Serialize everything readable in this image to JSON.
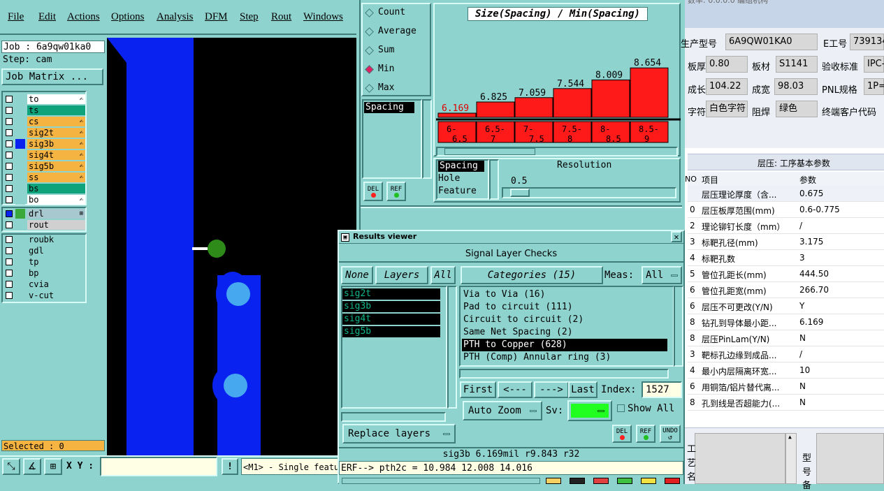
{
  "menu": [
    "File",
    "Edit",
    "Actions",
    "Options",
    "Analysis",
    "DFM",
    "Step",
    "Rout",
    "Windows"
  ],
  "job": {
    "job_label": "Job : 6a9qw01ka0",
    "step_label": "Step: cam",
    "matrix_btn": "Job Matrix ..."
  },
  "layers": [
    {
      "name": "to",
      "color": "#ffffff",
      "mark": "✍"
    },
    {
      "name": "ts",
      "color": "#0ea37a",
      "mark": ""
    },
    {
      "name": "cs",
      "color": "#f5b342",
      "mark": "✍"
    },
    {
      "name": "sig2t",
      "color": "#f5b342",
      "mark": "✍"
    },
    {
      "name": "sig3b",
      "color": "#f5b342",
      "mark": "✍"
    },
    {
      "name": "sig4t",
      "color": "#f5b342",
      "mark": "✍"
    },
    {
      "name": "sig5b",
      "color": "#f5b342",
      "mark": "✍"
    },
    {
      "name": "ss",
      "color": "#f5b342",
      "mark": "✍"
    },
    {
      "name": "bs",
      "color": "#0ea37a",
      "mark": ""
    },
    {
      "name": "bo",
      "color": "#ffffff",
      "mark": "✍"
    }
  ],
  "drill_layers": [
    {
      "name": "drl",
      "color": "#a8c8d0",
      "mark": "⊞"
    },
    {
      "name": "rout",
      "color": "#d0d0d0",
      "mark": ""
    }
  ],
  "other_layers": [
    "roubk",
    "gdl",
    "tp",
    "bp",
    "cvia",
    "v-cut"
  ],
  "selected_text": "Selected : 0",
  "xy_label": "X Y :",
  "status_msg": "<M1> - Single featu",
  "stats": {
    "options": [
      "Count",
      "Average",
      "Sum",
      "Min",
      "Max"
    ],
    "selected": "Min",
    "list_item": "Spacing",
    "del": "DEL",
    "ref": "REF"
  },
  "chart_data": {
    "type": "bar",
    "title": "Size(Spacing) / Min(Spacing)",
    "categories": [
      "6-\n6.5",
      "6.5-\n7",
      "7-\n7.5",
      "7.5-\n8",
      "8-\n8.5",
      "8.5-\n9"
    ],
    "cat_top": [
      "6-",
      "6.5-",
      "7-",
      "7.5-",
      "8-",
      "8.5-"
    ],
    "cat_bot": [
      "6.5",
      "7",
      "7.5",
      "8",
      "8.5",
      "9"
    ],
    "values": [
      6.169,
      6.825,
      7.059,
      7.544,
      8.009,
      8.654
    ],
    "value_labels": [
      "6.169",
      "6.825",
      "7.059",
      "7.544",
      "8.009",
      "8.654"
    ],
    "ylim": [
      6,
      9
    ]
  },
  "resolution": {
    "list": [
      "Spacing",
      "Hole",
      "Feature"
    ],
    "title": "Resolution",
    "value": "0.5"
  },
  "results": {
    "title": "Results viewer",
    "subtitle": "Signal Layer Checks",
    "none_btn": "None",
    "layers_btn": "Layers",
    "all_btn": "All",
    "categories_btn": "Categories (15)",
    "meas_label": "Meas:",
    "meas_value": "All",
    "layer_list": [
      "sig2t",
      "sig3b",
      "sig4t",
      "sig5b"
    ],
    "categories": [
      "Via to Via (16)",
      "Pad to circuit (111)",
      "Circuit to circuit (2)",
      "Same Net Spacing (2)",
      "PTH to Copper (628)",
      "PTH (Comp) Annular ring (3)"
    ],
    "selected_category": "PTH to Copper (628)",
    "first": "First",
    "prev": "<---",
    "next": "--->",
    "last": "Last",
    "index_label": "Index:",
    "index_value": "1527",
    "auto_zoom": "Auto Zoom",
    "sv_label": "Sv:",
    "show_all": "Show All",
    "replace_layers": "Replace layers",
    "del": "DEL",
    "ref": "REF",
    "undo": "UNDO",
    "status": "sig3b 6.169mil  r9.843  r32",
    "erf": "ERF--> pth2c = 10.984 12.008 14.016"
  },
  "cn_top": {
    "label_model": "生产型号",
    "model": "6A9QW01KA0",
    "label_eno": "E工号",
    "eno": "739134",
    "label_thick": "板厚",
    "thick": "0.80",
    "label_mat": "板材",
    "mat": "S1141",
    "label_std": "验收标准",
    "std": "IPC-",
    "label_len": "成长",
    "len": "104.22",
    "label_wid": "成宽",
    "wid": "98.03",
    "label_pnl": "PNL规格",
    "pnl": "1P=",
    "label_char": "字符",
    "char": "白色字符",
    "label_mask": "阻焊",
    "mask": "绿色",
    "label_cust": "终端客户代码"
  },
  "cn_table": {
    "title": "层压: 工序基本参数",
    "col_no": "NO",
    "col_item": "项目",
    "col_param": "参数",
    "rows": [
      {
        "no": "",
        "item": "层压理论厚度（含...",
        "param": "0.675"
      },
      {
        "no": "0",
        "item": "层压板厚范围(mm)",
        "param": "0.6-0.775"
      },
      {
        "no": "2",
        "item": "理论铆钉长度（mm）",
        "param": "/"
      },
      {
        "no": "3",
        "item": "标靶孔径(mm)",
        "param": "3.175"
      },
      {
        "no": "4",
        "item": "标靶孔数",
        "param": "3"
      },
      {
        "no": "5",
        "item": "管位孔距长(mm)",
        "param": "444.50"
      },
      {
        "no": "6",
        "item": "管位孔距宽(mm)",
        "param": "266.70"
      },
      {
        "no": "6",
        "item": "层压不可更改(Y/N)",
        "param": "Y"
      },
      {
        "no": "8",
        "item": "钻孔到导体最小距...",
        "param": "6.169"
      },
      {
        "no": "8",
        "item": "层压PinLam(Y/N)",
        "param": "N"
      },
      {
        "no": "3",
        "item": "靶标孔边缘到成品...",
        "param": "/"
      },
      {
        "no": "4",
        "item": "最小内层隔离环宽...",
        "param": "10"
      },
      {
        "no": "6",
        "item": "用铜箔/铝片替代离...",
        "param": "N"
      },
      {
        "no": "8",
        "item": "孔到线是否超能力(...",
        "param": "N"
      }
    ]
  },
  "cn_bottom": {
    "left_chars": [
      "工",
      "艺",
      "名"
    ],
    "right_chars": [
      "型",
      "号",
      "备"
    ]
  },
  "top_right_fragment": "数率: 0.0.0.0  编组机构"
}
